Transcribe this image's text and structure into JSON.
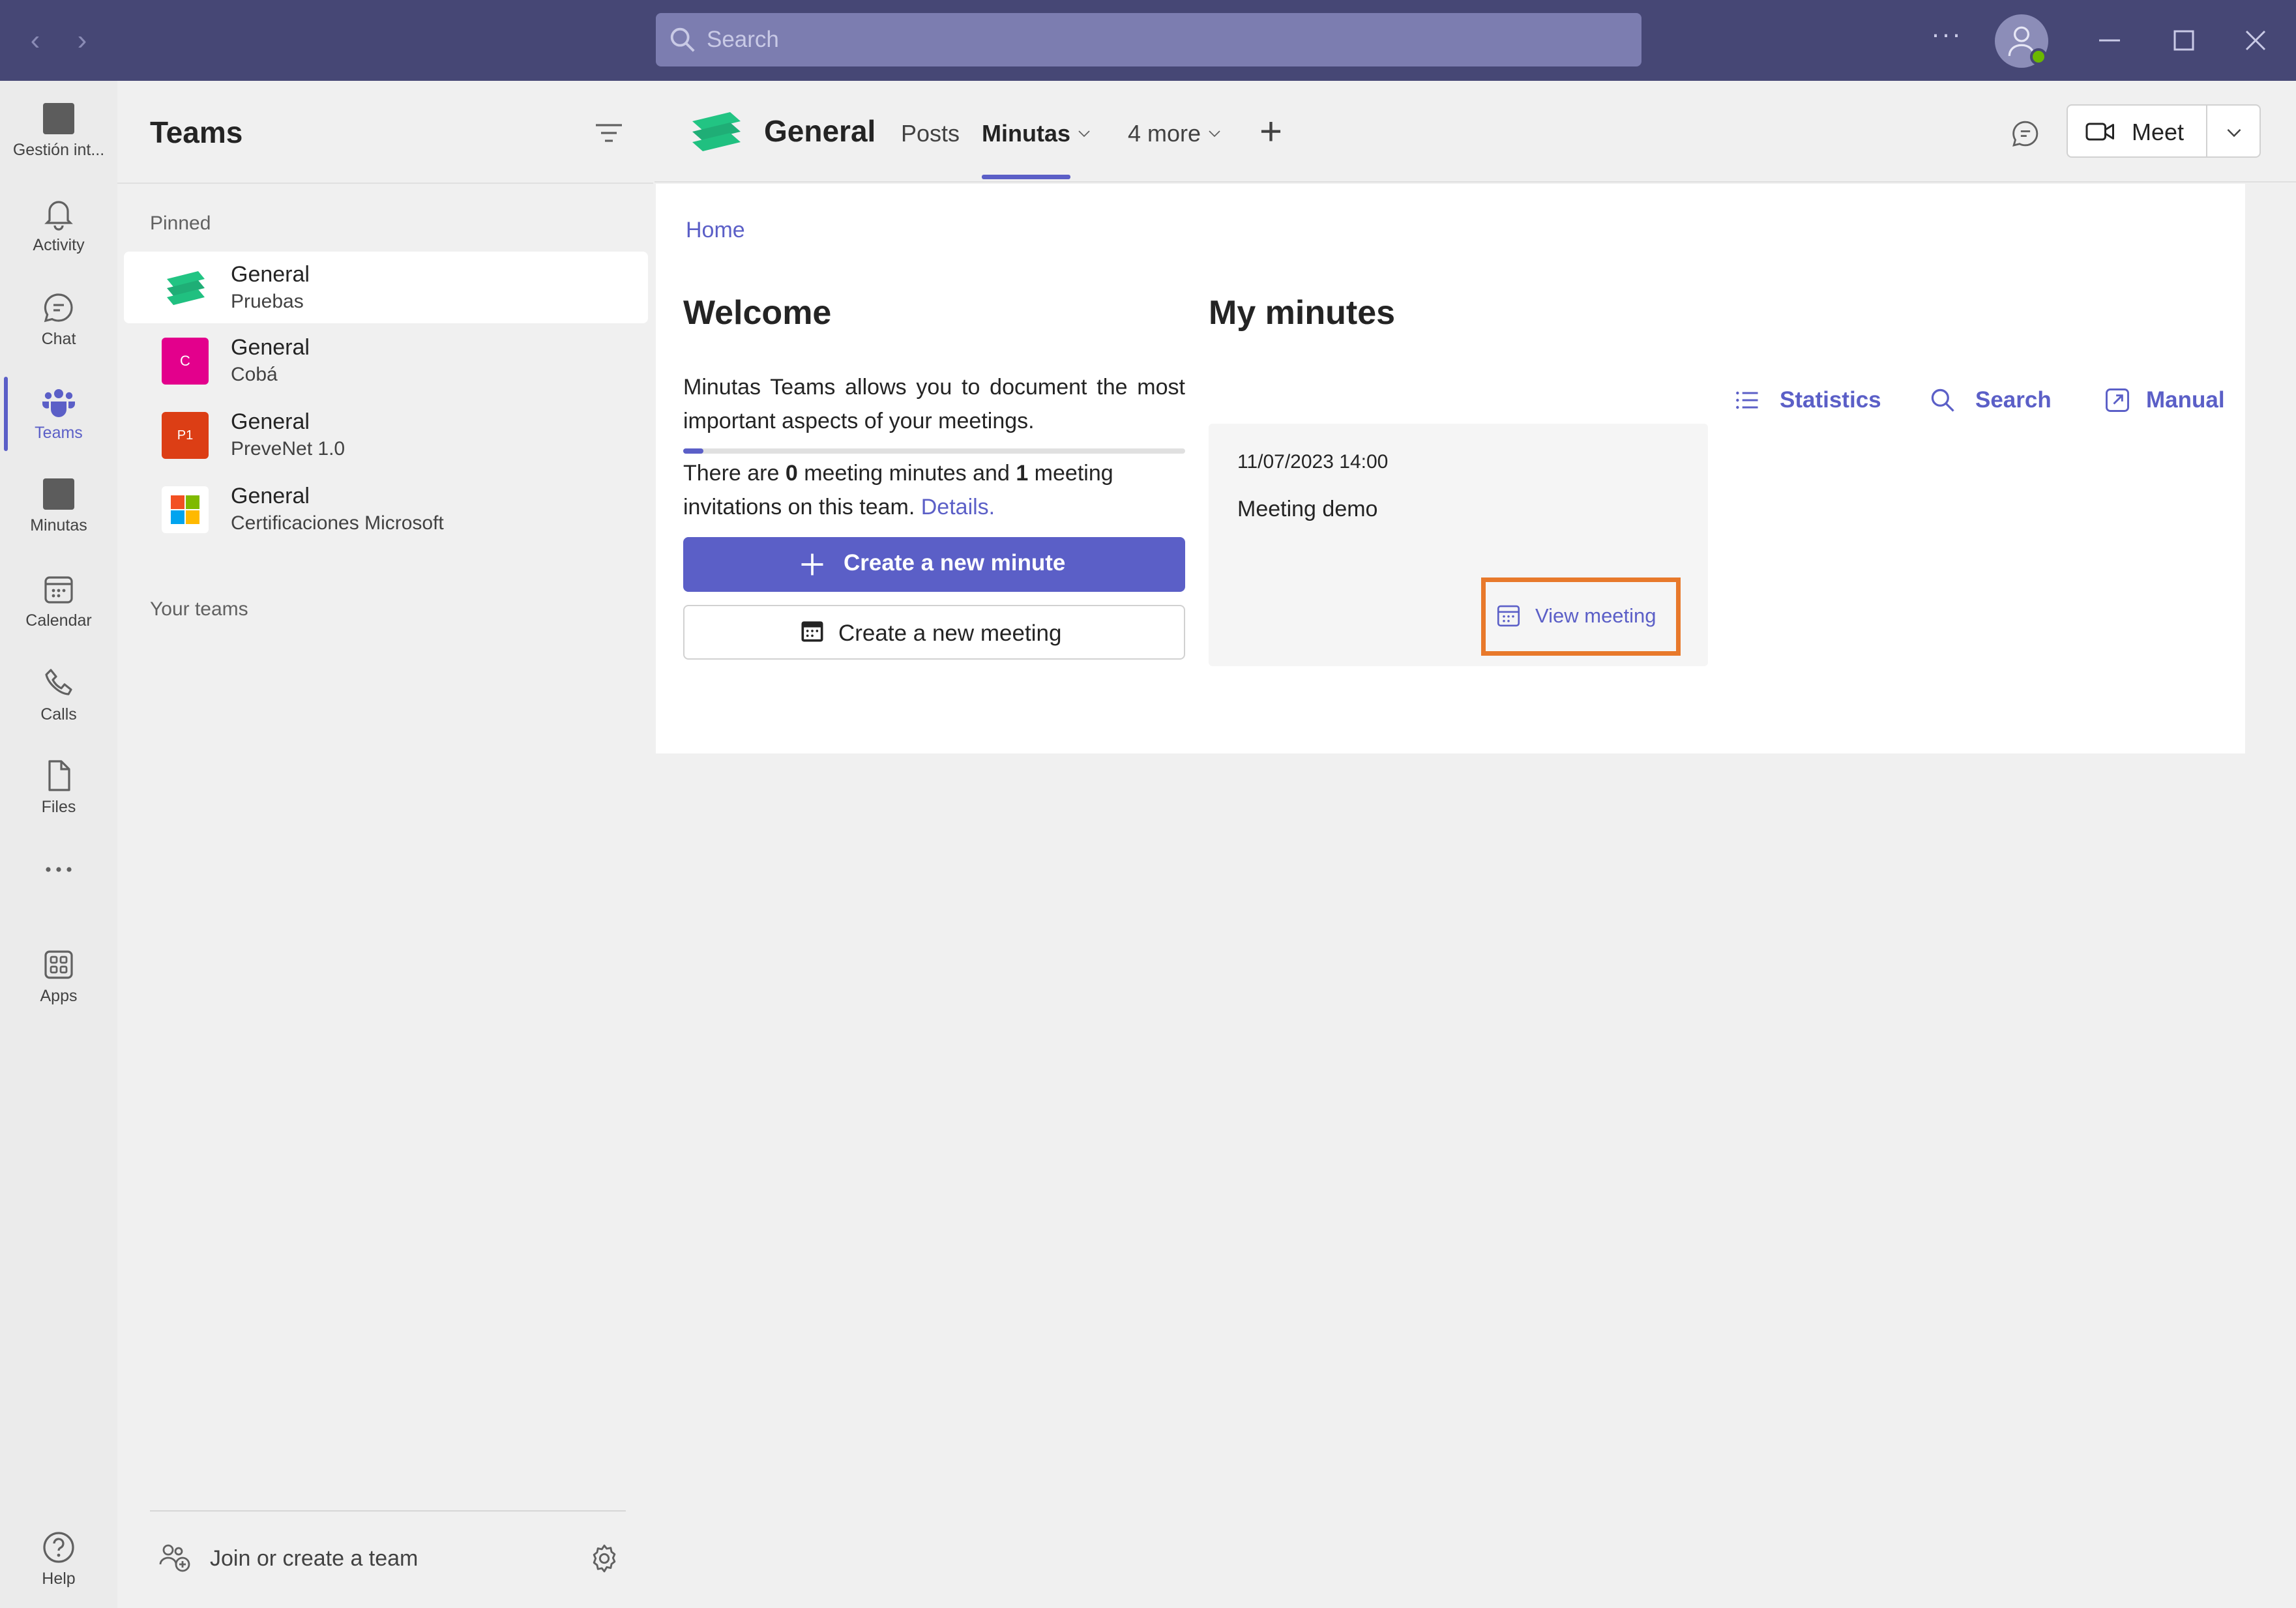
{
  "search": {
    "placeholder": "Search"
  },
  "colors": {
    "brand": "#464775",
    "accent": "#5b5fc7",
    "highlight": "#e8792b",
    "presence": "#6bb700"
  },
  "rail": {
    "items": [
      {
        "label": "Gestión int...",
        "icon": "app-icon"
      },
      {
        "label": "Activity",
        "icon": "bell-icon"
      },
      {
        "label": "Chat",
        "icon": "chat-icon"
      },
      {
        "label": "Teams",
        "icon": "teams-icon",
        "active": true
      },
      {
        "label": "Minutas",
        "icon": "app-icon"
      },
      {
        "label": "Calendar",
        "icon": "calendar-icon"
      },
      {
        "label": "Calls",
        "icon": "phone-icon"
      },
      {
        "label": "Files",
        "icon": "file-icon"
      },
      {
        "label": "Apps",
        "icon": "apps-icon"
      },
      {
        "label": "Help",
        "icon": "help-icon"
      }
    ]
  },
  "teams_panel": {
    "title": "Teams",
    "pinned_label": "Pinned",
    "your_teams_label": "Your teams",
    "pinned": [
      {
        "name": "General",
        "team": "Pruebas",
        "selected": true
      },
      {
        "name": "General",
        "team": "Cobá",
        "avatar_text": "C",
        "avatar_color": "#e3008c"
      },
      {
        "name": "General",
        "team": "PreveNet 1.0",
        "avatar_text": "P1",
        "avatar_color": "#dc3e15"
      },
      {
        "name": "General",
        "team": "Certificaciones Microsoft"
      }
    ],
    "join_label": "Join or create a team"
  },
  "channel": {
    "title": "General",
    "tabs": [
      {
        "label": "Posts"
      },
      {
        "label": "Minutas",
        "active": true
      },
      {
        "label": "4 more"
      }
    ],
    "meet_label": "Meet"
  },
  "page": {
    "breadcrumb": "Home",
    "welcome_title": "Welcome",
    "intro": "Minutas Teams allows you to document the most important aspects of your meetings.",
    "progress": 0.04,
    "counts": {
      "prefix": "There are ",
      "minutes_count": "0",
      "middle": " meeting minutes and ",
      "invitations_count": "1",
      "suffix": " meeting invitations on this team. ",
      "details_link": "Details."
    },
    "create_minute": "Create a new minute",
    "create_meeting": "Create a new meeting",
    "my_minutes_title": "My minutes",
    "actions": [
      {
        "label": "Statistics",
        "icon": "list-icon"
      },
      {
        "label": "Search",
        "icon": "search-icon"
      },
      {
        "label": "Manual",
        "icon": "external-link-icon"
      }
    ],
    "minute_card": {
      "date": "11/07/2023 14:00",
      "title": "Meeting demo",
      "view_label": "View meeting"
    }
  }
}
